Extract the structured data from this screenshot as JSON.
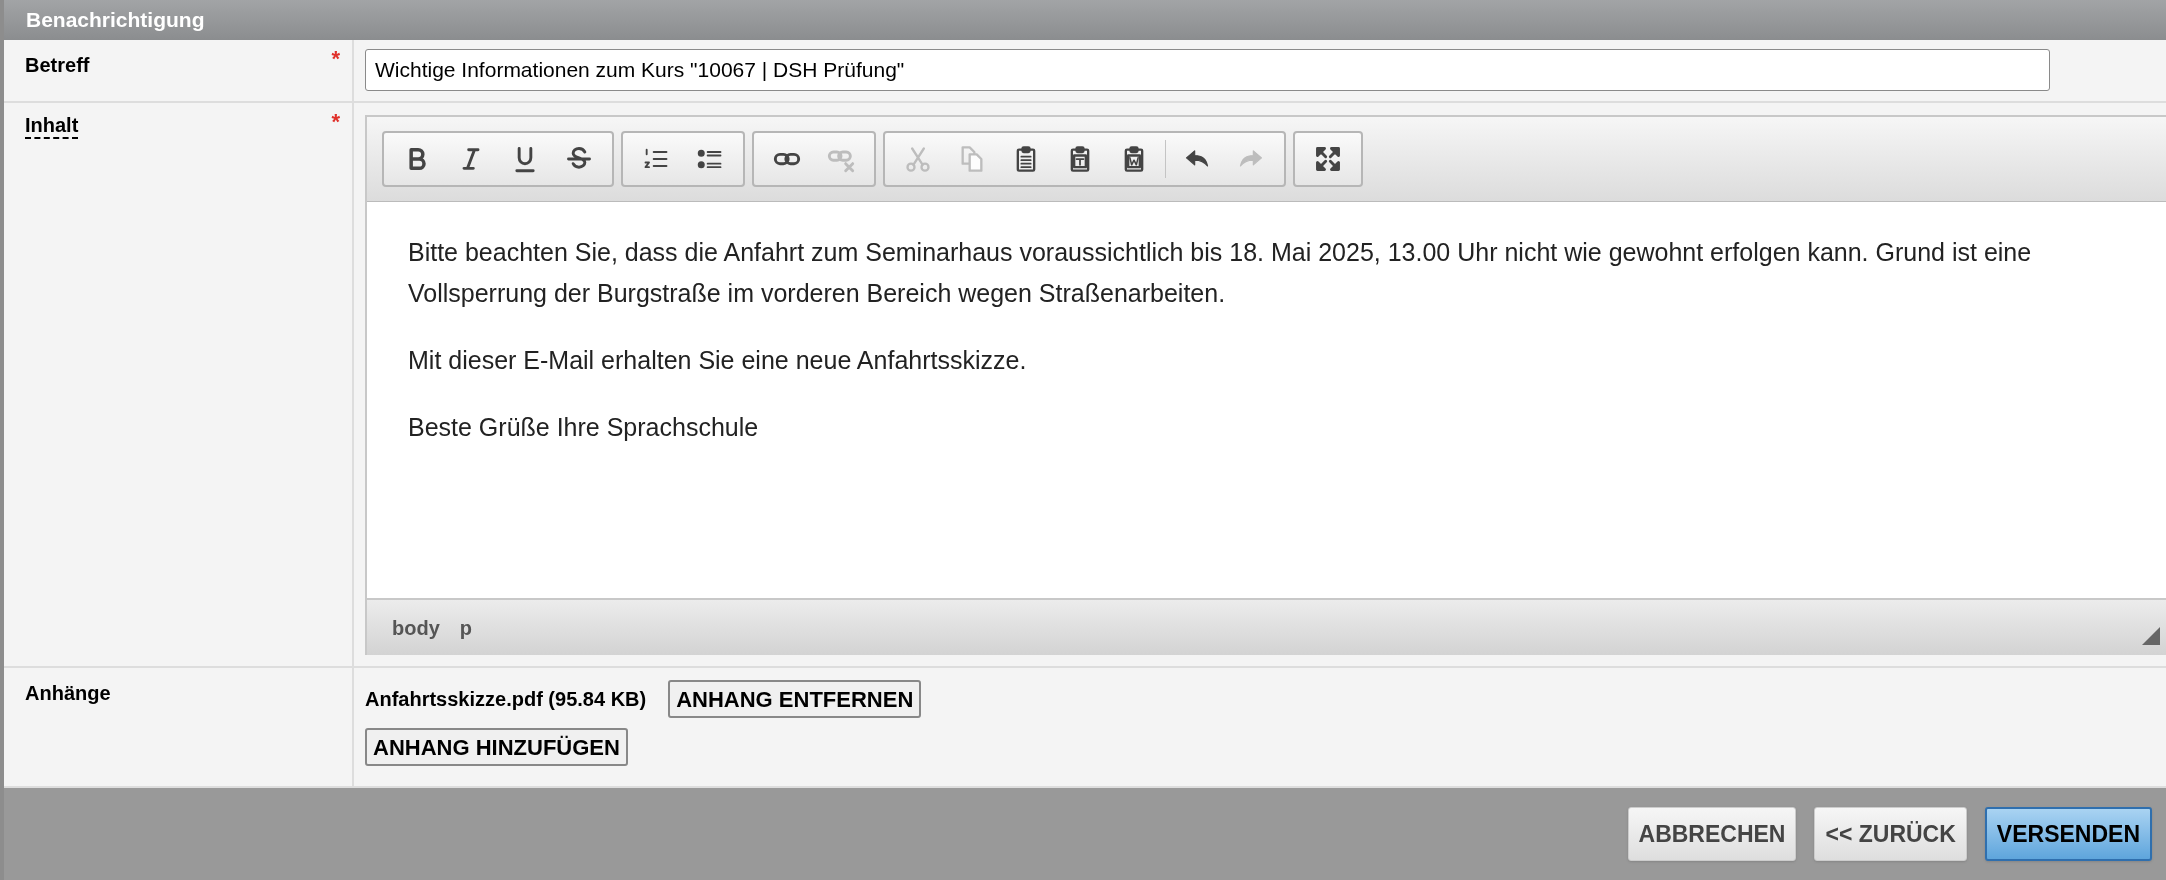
{
  "panel": {
    "title": "Benachrichtigung"
  },
  "subject": {
    "label": "Betreff",
    "required_marker": "*",
    "value": "Wichtige Informationen zum Kurs \"10067 | DSH Prüfung\""
  },
  "content": {
    "label": "Inhalt",
    "required_marker": "*",
    "toolbar": [
      {
        "buttons": [
          {
            "kind": "bold",
            "disabled": false
          },
          {
            "kind": "italic",
            "disabled": false
          },
          {
            "kind": "underline",
            "disabled": false
          },
          {
            "kind": "strike",
            "disabled": false
          }
        ]
      },
      {
        "buttons": [
          {
            "kind": "numbered-list",
            "disabled": false
          },
          {
            "kind": "bullet-list",
            "disabled": false
          }
        ]
      },
      {
        "buttons": [
          {
            "kind": "link",
            "disabled": false
          },
          {
            "kind": "unlink",
            "disabled": true
          }
        ]
      },
      {
        "buttons": [
          {
            "kind": "cut",
            "disabled": true
          },
          {
            "kind": "copy",
            "disabled": true
          },
          {
            "kind": "paste",
            "disabled": false
          },
          {
            "kind": "paste-text",
            "disabled": false
          },
          {
            "kind": "paste-word",
            "disabled": false
          },
          {
            "kind": "separator"
          },
          {
            "kind": "undo",
            "disabled": false
          },
          {
            "kind": "redo",
            "disabled": true
          }
        ]
      },
      {
        "buttons": [
          {
            "kind": "maximize",
            "disabled": false
          }
        ]
      }
    ],
    "paragraphs": [
      "Bitte beachten Sie, dass die Anfahrt zum Seminarhaus voraussichtlich bis 18. Mai 2025, 13.00 Uhr nicht wie gewohnt erfolgen kann. Grund ist eine Vollsperrung der Burgstraße im vorderen Bereich wegen Straßenarbeiten.",
      "Mit dieser E-Mail erhalten Sie eine neue Anfahrtsskizze.",
      "Beste Grüße Ihre Sprachschule"
    ],
    "path": [
      "body",
      "p"
    ]
  },
  "attachments": {
    "label": "Anhänge",
    "files": [
      {
        "name": "Anfahrtsskizze.pdf (95.84 KB)",
        "remove_button": "ANHANG ENTFERNEN"
      }
    ],
    "add_button": "ANHANG HINZUFÜGEN"
  },
  "footer_buttons": [
    {
      "label": "ABBRECHEN",
      "primary": false
    },
    {
      "label": "<< ZURÜCK",
      "primary": false
    },
    {
      "label": "VERSENDEN",
      "primary": true
    }
  ]
}
